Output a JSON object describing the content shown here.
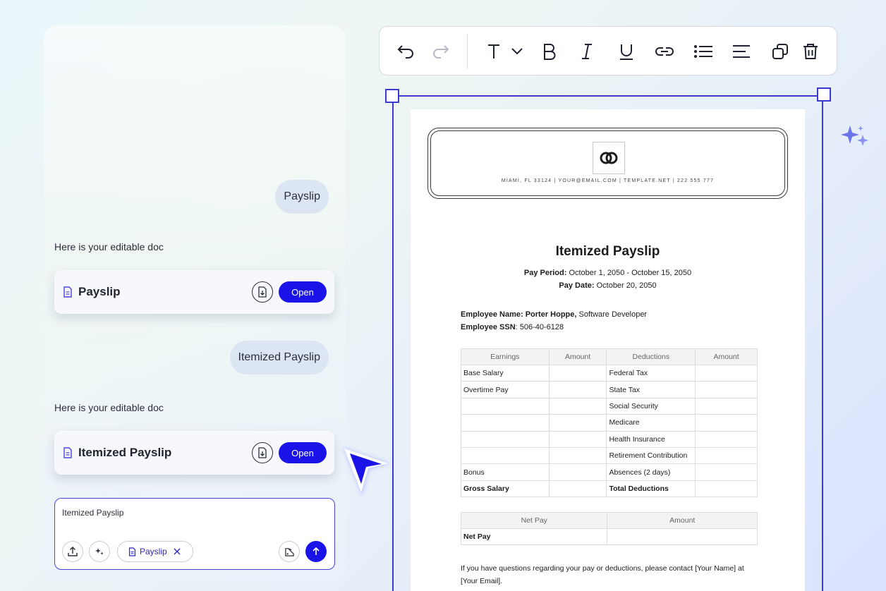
{
  "chat": {
    "messages": [
      {
        "role": "user",
        "text": "Payslip"
      },
      {
        "role": "assistant",
        "text": "Here is your editable doc"
      },
      {
        "role": "user",
        "text": "Itemized Payslip"
      },
      {
        "role": "assistant",
        "text": "Here is your editable doc"
      }
    ],
    "cards": [
      {
        "title": "Payslip",
        "open_label": "Open"
      },
      {
        "title": "Itemized Payslip",
        "open_label": "Open"
      }
    ],
    "composer": {
      "text": "Itemized Payslip",
      "chip_label": "Payslip"
    }
  },
  "toolbar": {
    "items": [
      "undo-icon",
      "redo-icon",
      "text-style-icon",
      "bold-icon",
      "italic-icon",
      "underline-icon",
      "link-icon",
      "list-icon",
      "align-icon",
      "duplicate-icon",
      "delete-icon"
    ]
  },
  "document": {
    "contact": "MIAMI, FL 33124 | YOUR@EMAIL.COM | TEMPLATE.NET | 222 555 777",
    "title": "Itemized Payslip",
    "pay_period_label": "Pay Period:",
    "pay_period": " October 1, 2050 - October 15, 2050",
    "pay_date_label": "Pay Date:",
    "pay_date": " October 20, 2050",
    "employee_name_label": "Employee Name: Porter Hoppe,",
    "employee_role": " Software Developer",
    "employee_ssn_label": "Employee SSN",
    "employee_ssn": ": 506-40-6128",
    "earnings_table": {
      "headers": [
        "Earnings",
        "Amount",
        "Deductions",
        "Amount"
      ],
      "rows": [
        [
          "Base Salary",
          "",
          "Federal Tax",
          ""
        ],
        [
          "Overtime Pay",
          "",
          "State Tax",
          ""
        ],
        [
          "",
          "",
          "Social Security",
          ""
        ],
        [
          "",
          "",
          "Medicare",
          ""
        ],
        [
          "",
          "",
          "Health Insurance",
          ""
        ],
        [
          "",
          "",
          "Retirement Contribution",
          ""
        ],
        [
          "Bonus",
          "",
          "Absences (2 days)",
          ""
        ],
        [
          "Gross Salary",
          "",
          "Total Deductions",
          ""
        ]
      ]
    },
    "net_table": {
      "headers": [
        "Net Pay",
        "Amount"
      ],
      "rows": [
        [
          "Net Pay",
          ""
        ]
      ]
    },
    "footer": "If you have questions regarding your pay or deductions, please contact [Your Name] at [Your Email]."
  },
  "colors": {
    "accent": "#1a13e8",
    "selection": "#3d3ad4"
  }
}
